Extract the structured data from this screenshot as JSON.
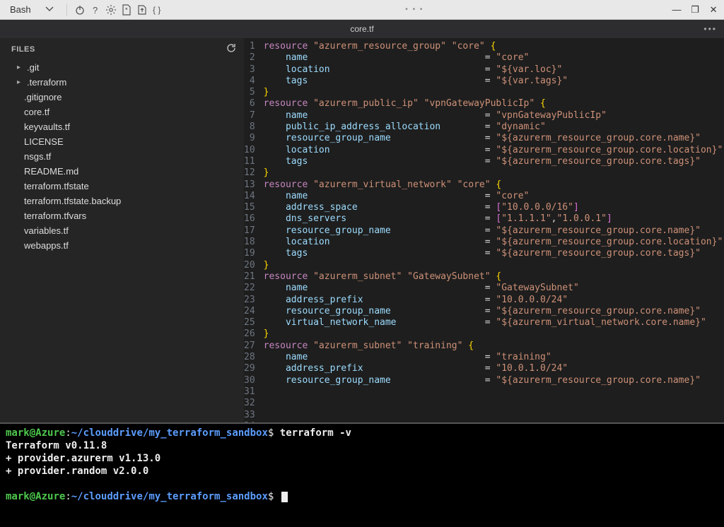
{
  "toolbar": {
    "shell": "Bash",
    "icons": [
      "power-icon",
      "help-icon",
      "settings-icon",
      "new-file-icon",
      "upload-icon",
      "braces-icon"
    ]
  },
  "window": {
    "min": "—",
    "max": "❐",
    "close": "✕"
  },
  "tab": {
    "filename": "core.tf"
  },
  "sidebar": {
    "header": "FILES",
    "items": [
      {
        "label": ".git",
        "folder": true
      },
      {
        "label": ".terraform",
        "folder": true
      },
      {
        "label": ".gitignore",
        "folder": false
      },
      {
        "label": "core.tf",
        "folder": false
      },
      {
        "label": "keyvaults.tf",
        "folder": false
      },
      {
        "label": "LICENSE",
        "folder": false
      },
      {
        "label": "nsgs.tf",
        "folder": false
      },
      {
        "label": "README.md",
        "folder": false
      },
      {
        "label": "terraform.tfstate",
        "folder": false
      },
      {
        "label": "terraform.tfstate.backup",
        "folder": false
      },
      {
        "label": "terraform.tfvars",
        "folder": false
      },
      {
        "label": "variables.tf",
        "folder": false
      },
      {
        "label": "webapps.tf",
        "folder": false
      }
    ]
  },
  "code": {
    "lines": [
      [
        [
          "kw",
          "resource "
        ],
        [
          "str",
          "\"azurerm_resource_group\" \"core\" "
        ],
        [
          "br",
          "{"
        ]
      ],
      [
        [
          "prop",
          "    name"
        ],
        [
          "op",
          "                                = "
        ],
        [
          "str",
          "\"core\""
        ]
      ],
      [
        [
          "prop",
          "    location"
        ],
        [
          "op",
          "                            = "
        ],
        [
          "str",
          "\"${var.loc}\""
        ]
      ],
      [
        [
          "prop",
          "    tags"
        ],
        [
          "op",
          "                                = "
        ],
        [
          "str",
          "\"${var.tags}\""
        ]
      ],
      [
        [
          "br",
          "}"
        ]
      ],
      [
        [
          "",
          ""
        ]
      ],
      [
        [
          "kw",
          "resource "
        ],
        [
          "str",
          "\"azurerm_public_ip\" \"vpnGatewayPublicIp\" "
        ],
        [
          "br",
          "{"
        ]
      ],
      [
        [
          "prop",
          "    name"
        ],
        [
          "op",
          "                                = "
        ],
        [
          "str",
          "\"vpnGatewayPublicIp\""
        ]
      ],
      [
        [
          "prop",
          "    public_ip_address_allocation"
        ],
        [
          "op",
          "        = "
        ],
        [
          "str",
          "\"dynamic\""
        ]
      ],
      [
        [
          "prop",
          "    resource_group_name"
        ],
        [
          "op",
          "                 = "
        ],
        [
          "str",
          "\"${azurerm_resource_group.core.name}\""
        ]
      ],
      [
        [
          "prop",
          "    location"
        ],
        [
          "op",
          "                            = "
        ],
        [
          "str",
          "\"${azurerm_resource_group.core.location}\""
        ]
      ],
      [
        [
          "prop",
          "    tags"
        ],
        [
          "op",
          "                                = "
        ],
        [
          "str",
          "\"${azurerm_resource_group.core.tags}\""
        ]
      ],
      [
        [
          "br",
          "}"
        ]
      ],
      [
        [
          "",
          ""
        ]
      ],
      [
        [
          "kw",
          "resource "
        ],
        [
          "str",
          "\"azurerm_virtual_network\" \"core\" "
        ],
        [
          "br",
          "{"
        ]
      ],
      [
        [
          "prop",
          "    name"
        ],
        [
          "op",
          "                                = "
        ],
        [
          "str",
          "\"core\""
        ]
      ],
      [
        [
          "prop",
          "    address_space"
        ],
        [
          "op",
          "                       = "
        ],
        [
          "br2",
          "["
        ],
        [
          "str",
          "\"10.0.0.0/16\""
        ],
        [
          "br2",
          "]"
        ]
      ],
      [
        [
          "prop",
          "    dns_servers"
        ],
        [
          "op",
          "                         = "
        ],
        [
          "br2",
          "["
        ],
        [
          "str",
          "\"1.1.1.1\""
        ],
        [
          "op",
          ","
        ],
        [
          "str",
          "\"1.0.0.1\""
        ],
        [
          "br2",
          "]"
        ]
      ],
      [
        [
          "prop",
          "    resource_group_name"
        ],
        [
          "op",
          "                 = "
        ],
        [
          "str",
          "\"${azurerm_resource_group.core.name}\""
        ]
      ],
      [
        [
          "prop",
          "    location"
        ],
        [
          "op",
          "                            = "
        ],
        [
          "str",
          "\"${azurerm_resource_group.core.location}\""
        ]
      ],
      [
        [
          "prop",
          "    tags"
        ],
        [
          "op",
          "                                = "
        ],
        [
          "str",
          "\"${azurerm_resource_group.core.tags}\""
        ]
      ],
      [
        [
          "br",
          "}"
        ]
      ],
      [
        [
          "",
          ""
        ]
      ],
      [
        [
          "kw",
          "resource "
        ],
        [
          "str",
          "\"azurerm_subnet\" \"GatewaySubnet\" "
        ],
        [
          "br",
          "{"
        ]
      ],
      [
        [
          "prop",
          "    name"
        ],
        [
          "op",
          "                                = "
        ],
        [
          "str",
          "\"GatewaySubnet\""
        ]
      ],
      [
        [
          "prop",
          "    address_prefix"
        ],
        [
          "op",
          "                      = "
        ],
        [
          "str",
          "\"10.0.0.0/24\""
        ]
      ],
      [
        [
          "prop",
          "    resource_group_name"
        ],
        [
          "op",
          "                 = "
        ],
        [
          "str",
          "\"${azurerm_resource_group.core.name}\""
        ]
      ],
      [
        [
          "prop",
          "    virtual_network_name"
        ],
        [
          "op",
          "                = "
        ],
        [
          "str",
          "\"${azurerm_virtual_network.core.name}\""
        ]
      ],
      [
        [
          "br",
          "}"
        ]
      ],
      [
        [
          "",
          ""
        ]
      ],
      [
        [
          "kw",
          "resource "
        ],
        [
          "str",
          "\"azurerm_subnet\" \"training\" "
        ],
        [
          "br",
          "{"
        ]
      ],
      [
        [
          "prop",
          "    name"
        ],
        [
          "op",
          "                                = "
        ],
        [
          "str",
          "\"training\""
        ]
      ],
      [
        [
          "prop",
          "    address_prefix"
        ],
        [
          "op",
          "                      = "
        ],
        [
          "str",
          "\"10.0.1.0/24\""
        ]
      ],
      [
        [
          "prop",
          "    resource_group_name"
        ],
        [
          "op",
          "                 = "
        ],
        [
          "str",
          "\"${azurerm_resource_group.core.name}\""
        ]
      ]
    ]
  },
  "terminal": {
    "user": "mark",
    "host": "Azure",
    "path": "~/clouddrive/my_terraform_sandbox",
    "prompt": "$",
    "cmd1": "terraform -v",
    "out": [
      "Terraform v0.11.8",
      "+ provider.azurerm v1.13.0",
      "+ provider.random v2.0.0"
    ]
  }
}
